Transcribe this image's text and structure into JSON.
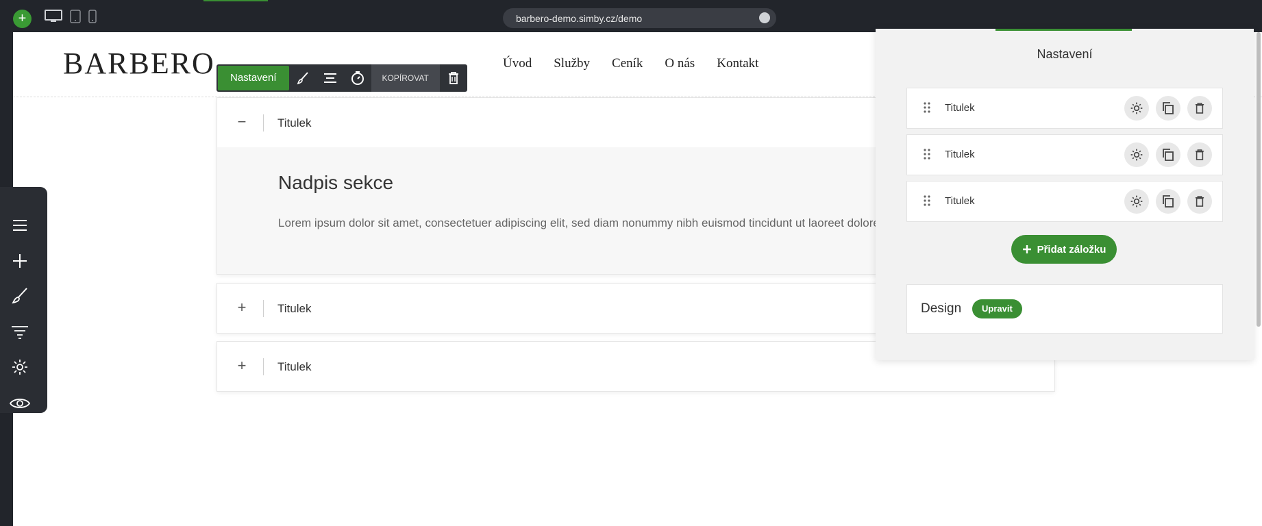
{
  "topbar": {
    "add_icon": "plus-icon",
    "url": "barbero-demo.simby.cz/demo",
    "device_icons": [
      "desktop-icon",
      "tablet-icon",
      "mobile-icon"
    ]
  },
  "site": {
    "logo": "BARBERO",
    "nav": [
      "Úvod",
      "Služby",
      "Ceník",
      "O nás",
      "Kontakt"
    ]
  },
  "toolbar": {
    "settings_label": "Nastavení",
    "copy_label": "KOPÍROVAT"
  },
  "accordion": {
    "items": [
      {
        "title": "Titulek",
        "expanded": true,
        "symbol": "−"
      },
      {
        "title": "Titulek",
        "expanded": false,
        "symbol": "+"
      },
      {
        "title": "Titulek",
        "expanded": false,
        "symbol": "+"
      }
    ],
    "content_heading": "Nadpis sekce",
    "content_text": "Lorem ipsum dolor sit amet, consectetuer adipiscing elit, sed diam nonummy nibh euismod tincidunt ut laoreet dolore magna aliquam erat volutpat."
  },
  "panel": {
    "title": "Nastavení",
    "tabs": [
      {
        "title": "Titulek"
      },
      {
        "title": "Titulek"
      },
      {
        "title": "Titulek"
      }
    ],
    "add_tab_label": "Přidat záložku",
    "design_label": "Design",
    "edit_label": "Upravit"
  },
  "colors": {
    "accent": "#3a8f33",
    "dark": "#22252b"
  }
}
